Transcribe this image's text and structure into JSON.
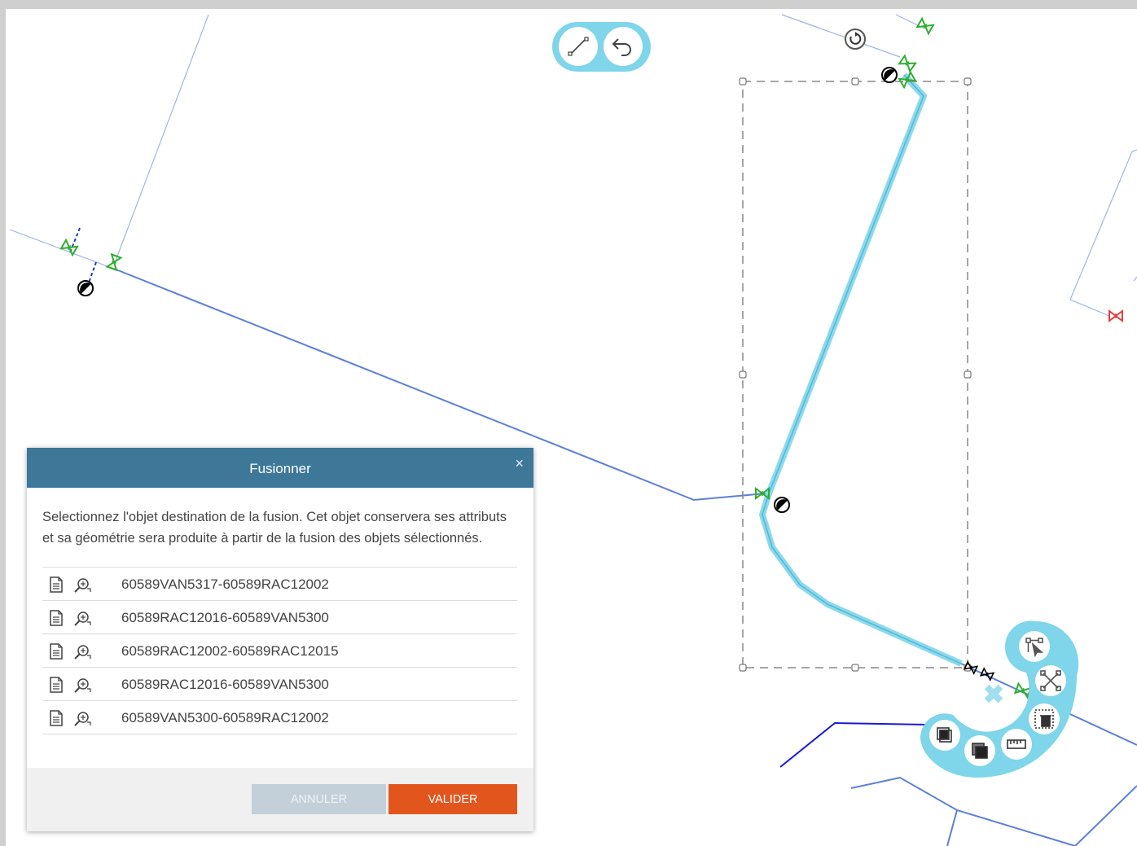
{
  "map": {
    "toolbar": {
      "draw_line_icon": "line-icon",
      "undo_icon": "undo-icon"
    },
    "rotate_handle_icon": "rotate-icon",
    "radial_menu": {
      "color": "#7fd5ea",
      "items": [
        "vertex-edit-icon",
        "split-icon",
        "delete-icon",
        "measure-icon",
        "bring-front-icon",
        "send-back-icon"
      ]
    }
  },
  "dialog": {
    "title": "Fusionner",
    "close": "×",
    "description": "Selectionnez l'objet destination de la fusion. Cet objet conservera ses attributs et sa géométrie sera produite à partir de la fusion des objets sélectionnés.",
    "items": [
      {
        "label": "60589VAN5317-60589RAC12002"
      },
      {
        "label": "60589RAC12016-60589VAN5300"
      },
      {
        "label": "60589RAC12002-60589RAC12015"
      },
      {
        "label": "60589RAC12016-60589VAN5300"
      },
      {
        "label": "60589VAN5300-60589RAC12002"
      }
    ],
    "cancel_label": "ANNULER",
    "validate_label": "VALIDER"
  },
  "colors": {
    "header": "#3d7898",
    "validate": "#e2561e",
    "cancel": "#c3d0da",
    "selection": "#7fd5ea",
    "network_line": "#5b80d6",
    "parcel_line": "#9fb5e6",
    "valve_open": "#2eae2e",
    "valve_closed": "#e04040"
  }
}
